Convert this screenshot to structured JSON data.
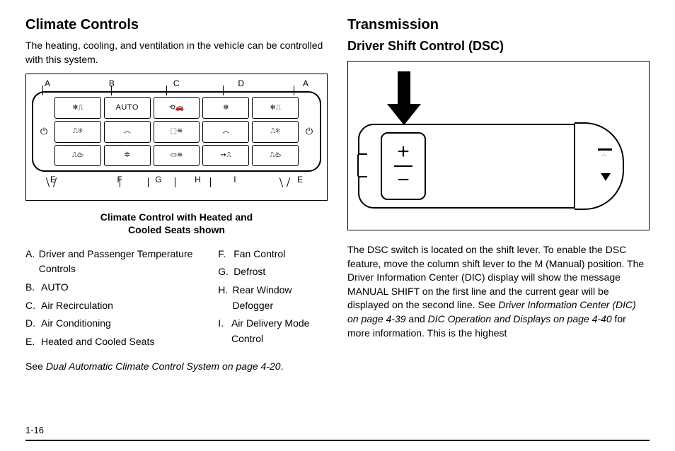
{
  "left": {
    "heading": "Climate Controls",
    "intro": "The heating, cooling, and ventilation in the vehicle can be controlled with this system.",
    "topLabels": [
      "A",
      "B",
      "C",
      "D",
      "A"
    ],
    "botLabels": [
      "E",
      "F",
      "G",
      "H",
      "I",
      "E"
    ],
    "autoLabel": "AUTO",
    "caption1": "Climate Control with Heated and",
    "caption2": "Cooled Seats shown",
    "legendL": [
      {
        "l": "A.",
        "t": "Driver and Passenger Temperature Controls"
      },
      {
        "l": "B.",
        "t": "AUTO"
      },
      {
        "l": "C.",
        "t": "Air Recirculation"
      },
      {
        "l": "D.",
        "t": "Air Conditioning"
      },
      {
        "l": "E.",
        "t": "Heated and Cooled Seats"
      }
    ],
    "legendR": [
      {
        "l": "F.",
        "t": "Fan Control"
      },
      {
        "l": "G.",
        "t": "Defrost"
      },
      {
        "l": "H.",
        "t": "Rear Window Defogger"
      },
      {
        "l": "I.",
        "t": "Air Delivery Mode Control"
      }
    ],
    "see1": "See ",
    "see2": "Dual Automatic Climate Control System on page 4‑20",
    "see3": "."
  },
  "right": {
    "heading1": "Transmission",
    "heading2": "Driver Shift Control (DSC)",
    "plus": "+",
    "minus": "−",
    "p1a": "The DSC switch is located on the shift lever. To enable the DSC feature, move the column shift lever to the M (Manual) position. The Driver Information Center (DIC) display will show the message MANUAL SHIFT on the first line and the current gear will be displayed on the second line. See ",
    "p1b": "Driver Information Center (DIC) on page 4‑39",
    "p1c": " and ",
    "p1d": "DIC Operation and Displays on page 4‑40",
    "p1e": " for more information. This is the highest"
  },
  "pageNumber": "1-16"
}
